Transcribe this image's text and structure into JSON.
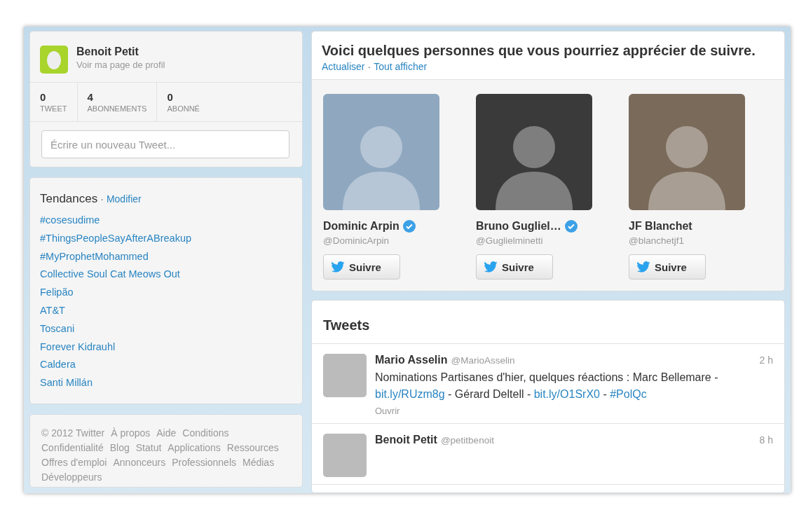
{
  "profile": {
    "name": "Benoit Petit",
    "link": "Voir ma page de profil",
    "stats": [
      {
        "value": "0",
        "label": "TWEET"
      },
      {
        "value": "4",
        "label": "ABONNEMENTS"
      },
      {
        "value": "0",
        "label": "ABONNÉ"
      }
    ],
    "compose": {
      "placeholder": "Écrire un nouveau Tweet..."
    }
  },
  "trends": {
    "title": "Tendances",
    "separator": "·",
    "edit": "Modifier",
    "items": [
      "#cosesudime",
      "#ThingsPeopleSayAfterABreakup",
      "#MyProphetMohammed",
      "Collective Soul Cat Meows Out",
      "Felipão",
      "AT&T",
      "Toscani",
      "Forever Kidrauhl",
      "Caldera",
      "Santi Millán"
    ]
  },
  "footer": {
    "links": [
      "© 2012 Twitter",
      "À propos",
      "Aide",
      "Conditions",
      "Confidentialité",
      "Blog",
      "Statut",
      "Applications",
      "Ressources",
      "Offres d'emploi",
      "Annonceurs",
      "Professionnels",
      "Médias",
      "Développeurs"
    ]
  },
  "suggestions": {
    "title": "Voici quelques personnes que vous pourriez apprécier de suivre.",
    "refresh": "Actualiser",
    "separator": "·",
    "show_all": "Tout afficher",
    "people": [
      {
        "name": "Dominic Arpin",
        "handle": "@DominicArpin",
        "verified": true,
        "button": "Suivre"
      },
      {
        "name": "Bruno Gugliel…",
        "handle": "@Guglielminetti",
        "verified": true,
        "button": "Suivre"
      },
      {
        "name": "JF Blanchet",
        "handle": "@blanchetjf1",
        "verified": false,
        "button": "Suivre"
      }
    ]
  },
  "tweets": {
    "title": "Tweets",
    "items": [
      {
        "name": "Mario Asselin",
        "handle": "@MarioAsselin",
        "time": "2 h",
        "segments": [
          {
            "text": "Nominations Partisanes d'hier, quelques réactions : Marc Bellemare - ",
            "link": false
          },
          {
            "text": "bit.ly/RUzm8g",
            "link": true
          },
          {
            "text": " - Gérard Deltell - ",
            "link": false
          },
          {
            "text": "bit.ly/O1SrX0",
            "link": true
          },
          {
            "text": " - ",
            "link": false
          },
          {
            "text": "#PolQc",
            "link": true
          }
        ],
        "action": "Ouvrir"
      },
      {
        "name": "Benoit Petit",
        "handle": "@petitbenoit",
        "time": "8 h"
      }
    ]
  }
}
